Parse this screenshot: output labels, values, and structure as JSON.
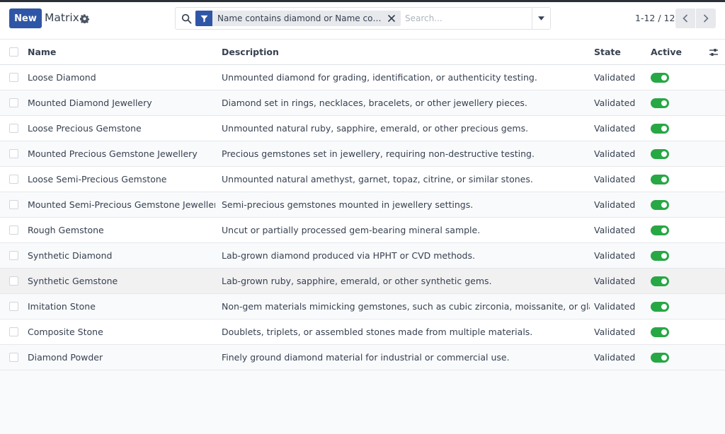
{
  "control_panel": {
    "new_label": "New",
    "title": "Matrix",
    "search": {
      "facet_text": "Name contains diamond or Name contains gemstone",
      "placeholder": "Search..."
    },
    "pager": {
      "value": "1-12 / 12"
    }
  },
  "list": {
    "columns": [
      "Name",
      "Description",
      "State",
      "Active"
    ],
    "rows": [
      {
        "name": "Loose Diamond",
        "description": "Unmounted diamond for grading, identification, or authenticity testing.",
        "state": "Validated",
        "active": true
      },
      {
        "name": "Mounted Diamond Jewellery",
        "description": "Diamond set in rings, necklaces, bracelets, or other jewellery pieces.",
        "state": "Validated",
        "active": true
      },
      {
        "name": "Loose Precious Gemstone",
        "description": "Unmounted natural ruby, sapphire, emerald, or other precious gems.",
        "state": "Validated",
        "active": true
      },
      {
        "name": "Mounted Precious Gemstone Jewellery",
        "description": "Precious gemstones set in jewellery, requiring non-destructive testing.",
        "state": "Validated",
        "active": true
      },
      {
        "name": "Loose Semi-Precious Gemstone",
        "description": "Unmounted natural amethyst, garnet, topaz, citrine, or similar stones.",
        "state": "Validated",
        "active": true
      },
      {
        "name": "Mounted Semi-Precious Gemstone Jewellery",
        "description": "Semi-precious gemstones mounted in jewellery settings.",
        "state": "Validated",
        "active": true
      },
      {
        "name": "Rough Gemstone",
        "description": "Uncut or partially processed gem-bearing mineral sample.",
        "state": "Validated",
        "active": true
      },
      {
        "name": "Synthetic Diamond",
        "description": "Lab-grown diamond produced via HPHT or CVD methods.",
        "state": "Validated",
        "active": true
      },
      {
        "name": "Synthetic Gemstone",
        "description": "Lab-grown ruby, sapphire, emerald, or other synthetic gems.",
        "state": "Validated",
        "active": true
      },
      {
        "name": "Imitation Stone",
        "description": "Non-gem materials mimicking gemstones, such as cubic zirconia, moissanite, or glass.",
        "state": "Validated",
        "active": true
      },
      {
        "name": "Composite Stone",
        "description": "Doublets, triplets, or assembled stones made from multiple materials.",
        "state": "Validated",
        "active": true
      },
      {
        "name": "Diamond Powder",
        "description": "Finely ground diamond material for industrial or commercial use.",
        "state": "Validated",
        "active": true
      }
    ]
  },
  "colors": {
    "primary": "#2f56a6",
    "toggle_on": "#28a745"
  }
}
